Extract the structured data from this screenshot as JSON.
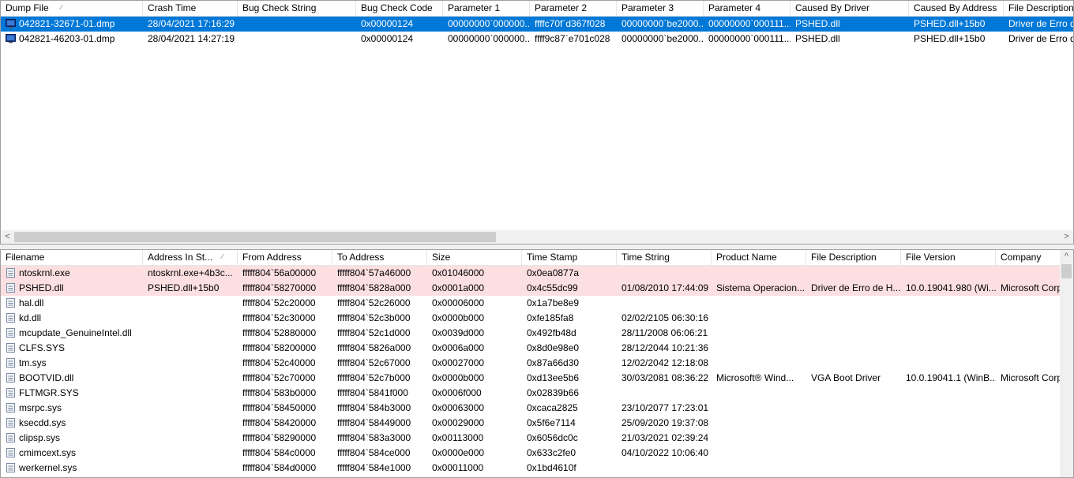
{
  "top": {
    "columns": [
      {
        "label": "Dump File",
        "width": 180
      },
      {
        "label": "Crash Time",
        "width": 120
      },
      {
        "label": "Bug Check String",
        "width": 150
      },
      {
        "label": "Bug Check Code",
        "width": 110
      },
      {
        "label": "Parameter 1",
        "width": 110
      },
      {
        "label": "Parameter 2",
        "width": 110
      },
      {
        "label": "Parameter 3",
        "width": 110
      },
      {
        "label": "Parameter 4",
        "width": 110
      },
      {
        "label": "Caused By Driver",
        "width": 150
      },
      {
        "label": "Caused By Address",
        "width": 120
      },
      {
        "label": "File Description",
        "width": 90
      }
    ],
    "sort_indicator": "⁄",
    "rows": [
      {
        "cells": [
          "042821-32671-01.dmp",
          "28/04/2021 17:16:29",
          "",
          "0x00000124",
          "00000000`000000...",
          "ffffc70f`d367f028",
          "00000000`be2000...",
          "00000000`000111...",
          "PSHED.dll",
          "PSHED.dll+15b0",
          "Driver de Erro de"
        ],
        "selected": true
      },
      {
        "cells": [
          "042821-46203-01.dmp",
          "28/04/2021 14:27:19",
          "",
          "0x00000124",
          "00000000`000000...",
          "ffff9c87`e701c028",
          "00000000`be2000...",
          "00000000`000111...",
          "PSHED.dll",
          "PSHED.dll+15b0",
          "Driver de Erro de"
        ],
        "selected": false
      }
    ],
    "scroll_left": "<",
    "scroll_right": ">"
  },
  "bottom": {
    "columns": [
      {
        "label": "Filename",
        "width": 180
      },
      {
        "label": "Address In St...",
        "width": 120
      },
      {
        "label": "From Address",
        "width": 120
      },
      {
        "label": "To Address",
        "width": 120
      },
      {
        "label": "Size",
        "width": 120
      },
      {
        "label": "Time Stamp",
        "width": 120
      },
      {
        "label": "Time String",
        "width": 120
      },
      {
        "label": "Product Name",
        "width": 120
      },
      {
        "label": "File Description",
        "width": 120
      },
      {
        "label": "File Version",
        "width": 120
      },
      {
        "label": "Company",
        "width": 100
      }
    ],
    "sort_indicator": "⁄",
    "rows": [
      {
        "cells": [
          "ntoskrnl.exe",
          "ntoskrnl.exe+4b3c...",
          "fffff804`56a00000",
          "fffff804`57a46000",
          "0x01046000",
          "0x0ea0877a",
          "",
          "",
          "",
          "",
          ""
        ],
        "highlight": true
      },
      {
        "cells": [
          "PSHED.dll",
          "PSHED.dll+15b0",
          "fffff804`58270000",
          "fffff804`5828a000",
          "0x0001a000",
          "0x4c55dc99",
          "01/08/2010 17:44:09",
          "Sistema Operacion...",
          "Driver de Erro de H...",
          "10.0.19041.980 (Wi...",
          "Microsoft Corp"
        ],
        "highlight": true
      },
      {
        "cells": [
          "hal.dll",
          "",
          "fffff804`52c20000",
          "fffff804`52c26000",
          "0x00006000",
          "0x1a7be8e9",
          "",
          "",
          "",
          "",
          ""
        ],
        "highlight": false
      },
      {
        "cells": [
          "kd.dll",
          "",
          "fffff804`52c30000",
          "fffff804`52c3b000",
          "0x0000b000",
          "0xfe185fa8",
          "02/02/2105 06:30:16",
          "",
          "",
          "",
          ""
        ],
        "highlight": false
      },
      {
        "cells": [
          "mcupdate_GenuineIntel.dll",
          "",
          "fffff804`52880000",
          "fffff804`52c1d000",
          "0x0039d000",
          "0x492fb48d",
          "28/11/2008 06:06:21",
          "",
          "",
          "",
          ""
        ],
        "highlight": false
      },
      {
        "cells": [
          "CLFS.SYS",
          "",
          "fffff804`58200000",
          "fffff804`5826a000",
          "0x0006a000",
          "0x8d0e98e0",
          "28/12/2044 10:21:36",
          "",
          "",
          "",
          ""
        ],
        "highlight": false
      },
      {
        "cells": [
          "tm.sys",
          "",
          "fffff804`52c40000",
          "fffff804`52c67000",
          "0x00027000",
          "0x87a66d30",
          "12/02/2042 12:18:08",
          "",
          "",
          "",
          ""
        ],
        "highlight": false
      },
      {
        "cells": [
          "BOOTVID.dll",
          "",
          "fffff804`52c70000",
          "fffff804`52c7b000",
          "0x0000b000",
          "0xd13ee5b6",
          "30/03/2081 08:36:22",
          "Microsoft® Wind...",
          "VGA Boot Driver",
          "10.0.19041.1 (WinB...",
          "Microsoft Corp"
        ],
        "highlight": false
      },
      {
        "cells": [
          "FLTMGR.SYS",
          "",
          "fffff804`583b0000",
          "fffff804`5841f000",
          "0x0006f000",
          "0x02839b66",
          "",
          "",
          "",
          "",
          ""
        ],
        "highlight": false
      },
      {
        "cells": [
          "msrpc.sys",
          "",
          "fffff804`58450000",
          "fffff804`584b3000",
          "0x00063000",
          "0xcaca2825",
          "23/10/2077 17:23:01",
          "",
          "",
          "",
          ""
        ],
        "highlight": false
      },
      {
        "cells": [
          "ksecdd.sys",
          "",
          "fffff804`58420000",
          "fffff804`58449000",
          "0x00029000",
          "0x5f6e7114",
          "25/09/2020 19:37:08",
          "",
          "",
          "",
          ""
        ],
        "highlight": false
      },
      {
        "cells": [
          "clipsp.sys",
          "",
          "fffff804`58290000",
          "fffff804`583a3000",
          "0x00113000",
          "0x6056dc0c",
          "21/03/2021 02:39:24",
          "",
          "",
          "",
          ""
        ],
        "highlight": false
      },
      {
        "cells": [
          "cmimcext.sys",
          "",
          "fffff804`584c0000",
          "fffff804`584ce000",
          "0x0000e000",
          "0x633c2fe0",
          "04/10/2022 10:06:40",
          "",
          "",
          "",
          ""
        ],
        "highlight": false
      },
      {
        "cells": [
          "werkernel.sys",
          "",
          "fffff804`584d0000",
          "fffff804`584e1000",
          "0x00011000",
          "0x1bd4610f",
          "",
          "",
          "",
          "",
          ""
        ],
        "highlight": false
      }
    ],
    "scroll_up": "^"
  },
  "colors": {
    "selected": "#0078d7",
    "highlight": "#fcdfe1"
  },
  "icons": {
    "dump": "monitor-icon",
    "module": "file-icon"
  }
}
